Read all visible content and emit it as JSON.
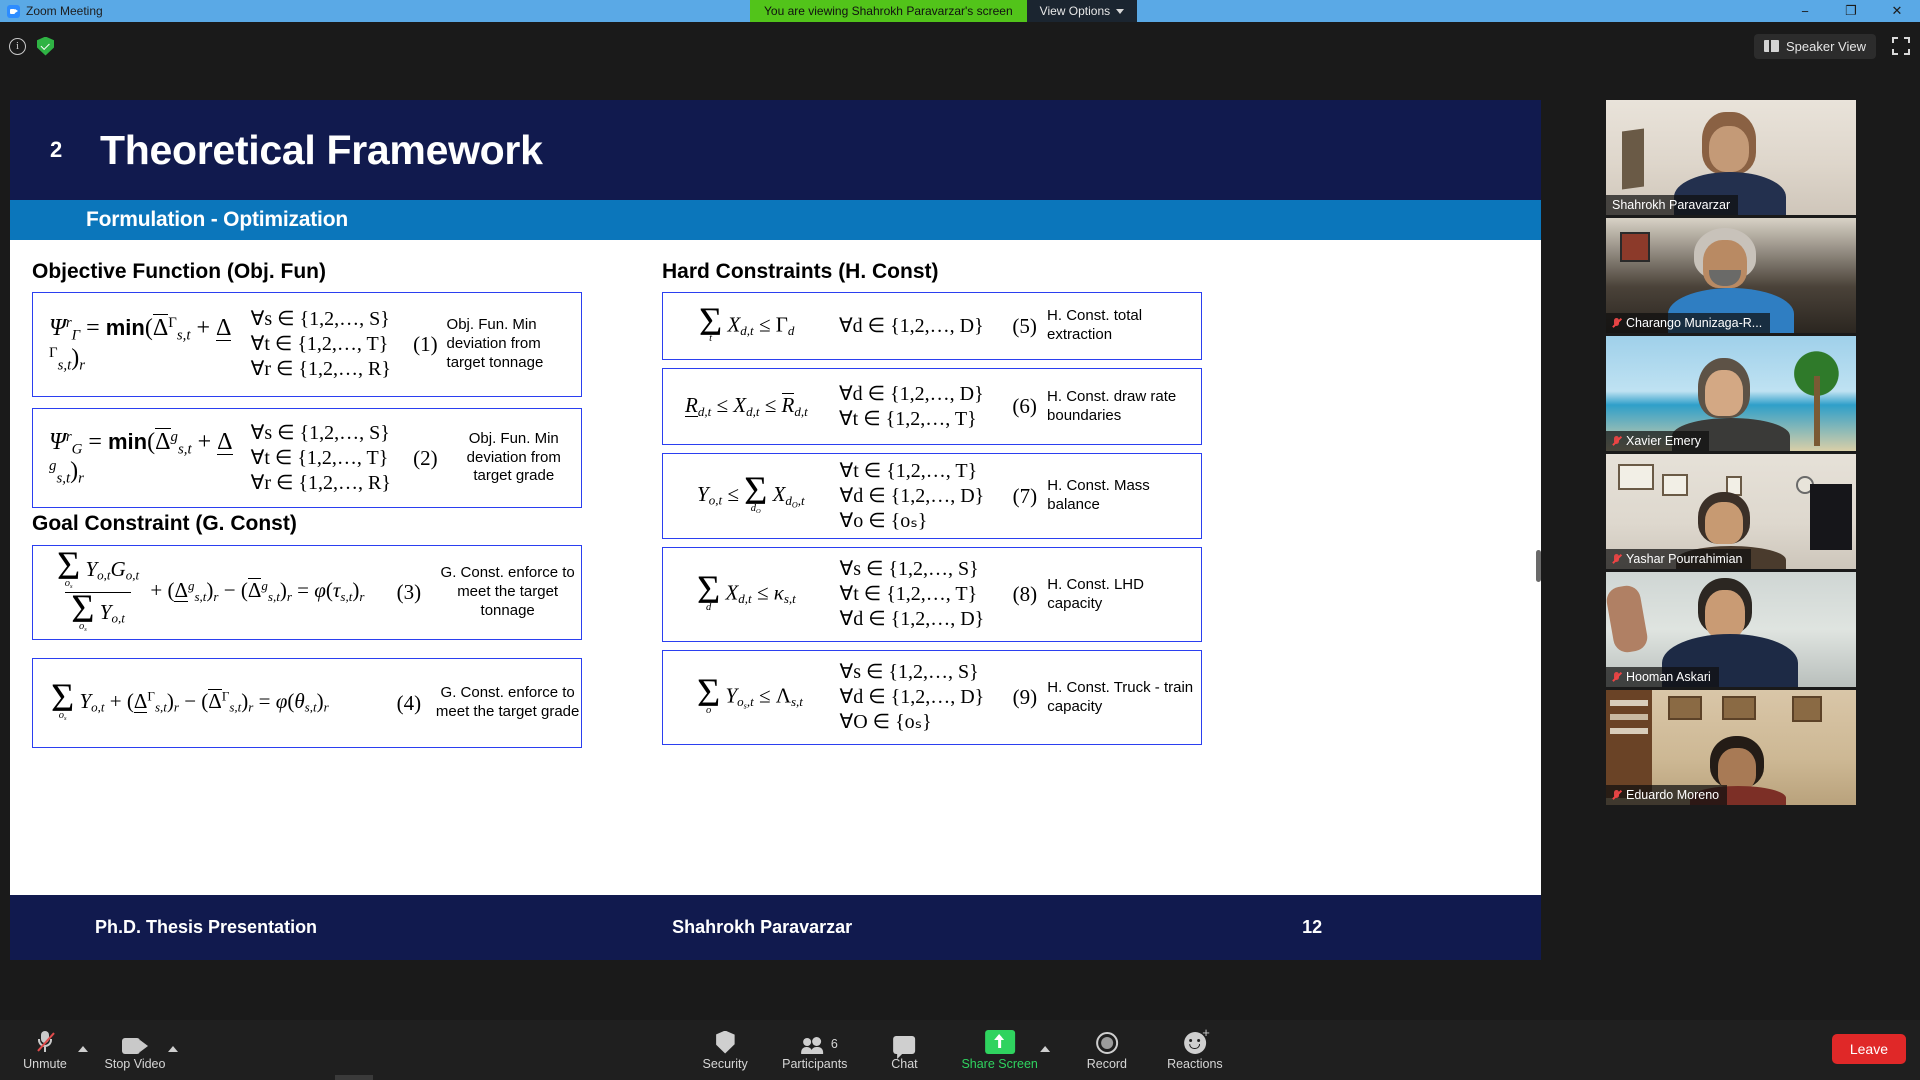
{
  "window": {
    "app_title": "Zoom Meeting",
    "minimize": "−",
    "restore": "❐",
    "close": "✕"
  },
  "share_banner": {
    "text": "You are viewing Shahrokh Paravarzar's screen",
    "view_options": "View Options"
  },
  "meetbar": {
    "speaker_view": "Speaker View"
  },
  "slide": {
    "number": "2",
    "title": "Theoretical Framework",
    "subtitle": "Formulation - Optimization",
    "left_heading_1": "Objective Function (Obj. Fun)",
    "left_heading_2": "Goal Constraint (G. Const)",
    "right_heading": "Hard Constraints (H. Const)",
    "footer_left": "Ph.D. Thesis Presentation",
    "footer_center": "Shahrokh Paravarzar",
    "footer_right": "12",
    "header_bg": "#111a4e",
    "subbar_bg": "#0b76bb",
    "box_border": "#2b3ff0"
  },
  "equations": {
    "eq1": {
      "number": "(1)",
      "description": "Obj. Fun. Min deviation from target tonnage",
      "quantifiers": [
        "∀s ∈ {1,2,…, S}",
        "∀t ∈ {1,2,…, T}",
        "∀r ∈ {1,2,…, R}"
      ]
    },
    "eq2": {
      "number": "(2)",
      "description": "Obj. Fun. Min deviation from target grade",
      "quantifiers": [
        "∀s ∈ {1,2,…, S}",
        "∀t ∈ {1,2,…, T}",
        "∀r ∈ {1,2,…, R}"
      ]
    },
    "eq3": {
      "number": "(3)",
      "description": "G. Const. enforce to meet the target tonnage"
    },
    "eq4": {
      "number": "(4)",
      "description": "G. Const. enforce to meet the target grade"
    },
    "eq5": {
      "number": "(5)",
      "description": "H. Const. total extraction",
      "quantifiers": [
        "∀d ∈ {1,2,…, D}"
      ]
    },
    "eq6": {
      "number": "(6)",
      "description": "H. Const. draw rate boundaries",
      "quantifiers": [
        "∀d ∈ {1,2,…, D}",
        "∀t ∈ {1,2,…, T}"
      ]
    },
    "eq7": {
      "number": "(7)",
      "description": "H. Const. Mass balance",
      "quantifiers": [
        "∀t ∈ {1,2,…, T}",
        "∀d ∈ {1,2,…, D}",
        "∀o ∈ {oₛ}"
      ]
    },
    "eq8": {
      "number": "(8)",
      "description": "H. Const. LHD capacity",
      "quantifiers": [
        "∀s ∈ {1,2,…, S}",
        "∀t ∈ {1,2,…, T}",
        "∀d ∈ {1,2,…, D}"
      ]
    },
    "eq9": {
      "number": "(9)",
      "description": "H. Const. Truck - train capacity",
      "quantifiers": [
        "∀s ∈ {1,2,…, S}",
        "∀d ∈ {1,2,…, D}",
        "∀O ∈ {oₛ}"
      ]
    }
  },
  "participants": [
    {
      "name": "Shahrokh Paravarzar",
      "muted": false,
      "active_speaker": true
    },
    {
      "name": "Charango Munizaga-R...",
      "muted": true,
      "active_speaker": false
    },
    {
      "name": "Xavier Emery",
      "muted": true,
      "active_speaker": false
    },
    {
      "name": "Yashar Pourrahimian",
      "muted": true,
      "active_speaker": false
    },
    {
      "name": "Hooman Askari",
      "muted": true,
      "active_speaker": false
    },
    {
      "name": "Eduardo Moreno",
      "muted": true,
      "active_speaker": false
    }
  ],
  "controls": {
    "unmute": "Unmute",
    "stop_video": "Stop Video",
    "security": "Security",
    "participants": "Participants",
    "participants_count": "6",
    "chat": "Chat",
    "share_screen": "Share Screen",
    "record": "Record",
    "reactions": "Reactions",
    "leave": "Leave"
  }
}
